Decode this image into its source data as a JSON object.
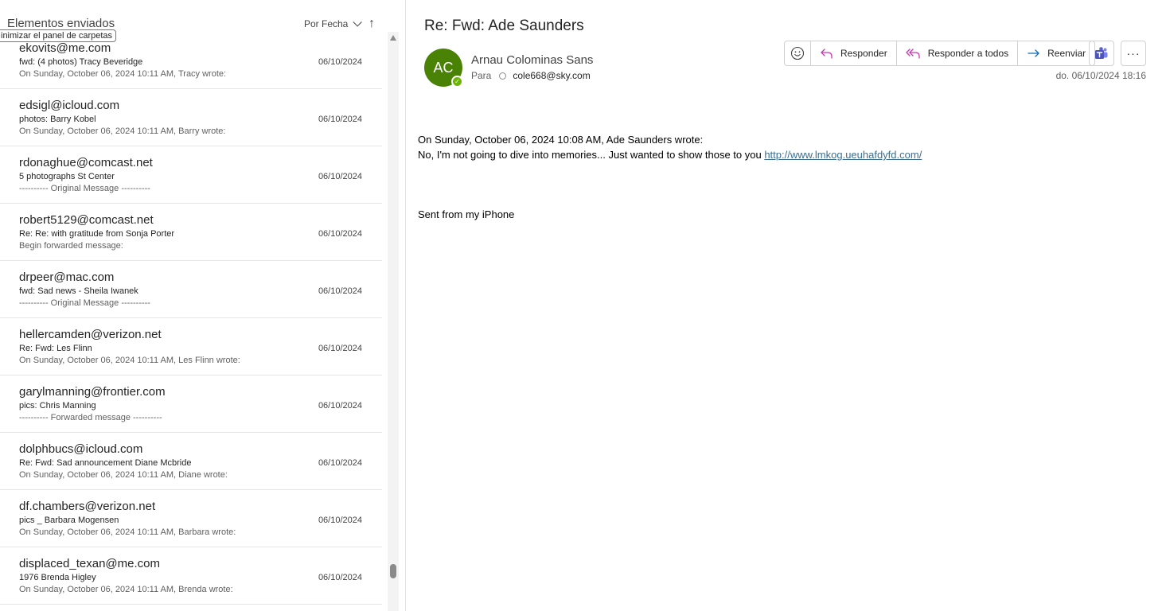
{
  "list": {
    "folder_title": "Elementos enviados",
    "sort_label": "Por Fecha",
    "sort_direction_icon": "↑",
    "tooltip": "inimizar el panel de carpetas",
    "messages": [
      {
        "from": "ekovits@me.com",
        "subject": "fwd: (4 photos) Tracy Beveridge",
        "preview": "On Sunday, October 06, 2024 10:11 AM, Tracy wrote:",
        "date": "06/10/2024"
      },
      {
        "from": "edsigl@icloud.com",
        "subject": "photos: Barry Kobel",
        "preview": "On Sunday, October 06, 2024 10:11 AM, Barry wrote:",
        "date": "06/10/2024"
      },
      {
        "from": "rdonaghue@comcast.net",
        "subject": "5 photographs St Center",
        "preview": "---------- Original Message ----------",
        "date": "06/10/2024"
      },
      {
        "from": "robert5129@comcast.net",
        "subject": "Re: Re: with gratitude from Sonja Porter",
        "preview": "Begin forwarded message:",
        "date": "06/10/2024"
      },
      {
        "from": "drpeer@mac.com",
        "subject": "fwd: Sad news - Sheila Iwanek",
        "preview": "---------- Original Message ----------",
        "date": "06/10/2024"
      },
      {
        "from": "hellercamden@verizon.net",
        "subject": "Re: Fwd: Les Flinn",
        "preview": "On Sunday, October 06, 2024 10:11 AM, Les Flinn wrote:",
        "date": "06/10/2024"
      },
      {
        "from": "garylmanning@frontier.com",
        "subject": "pics: Chris Manning",
        "preview": "---------- Forwarded message ----------",
        "date": "06/10/2024"
      },
      {
        "from": "dolphbucs@icloud.com",
        "subject": "Re: Fwd: Sad announcement Diane Mcbride",
        "preview": "On Sunday, October 06, 2024 10:11 AM, Diane wrote:",
        "date": "06/10/2024"
      },
      {
        "from": "df.chambers@verizon.net",
        "subject": "pics _ Barbara Mogensen",
        "preview": "On Sunday, October 06, 2024 10:11 AM, Barbara wrote:",
        "date": "06/10/2024"
      },
      {
        "from": "displaced_texan@me.com",
        "subject": "1976 Brenda Higley",
        "preview": "On Sunday, October 06, 2024 10:11 AM, Brenda wrote:",
        "date": "06/10/2024"
      }
    ]
  },
  "reading": {
    "subject": "Re: Fwd: Ade Saunders",
    "avatar_initials": "AC",
    "avatar_color": "#498205",
    "sender": "Arnau Colominas Sans",
    "to_label": "Para",
    "recipient": "cole668@sky.com",
    "sent_time": "do. 06/10/2024 18:16",
    "actions": {
      "emoji_icon": "smiley-icon",
      "reply": "Responder",
      "reply_all": "Responder a todos",
      "forward": "Reenviar"
    },
    "more_label": "···",
    "body": {
      "line1": "On Sunday, October 06, 2024 10:08 AM, Ade Saunders wrote:",
      "line2": "No, I'm not going to dive into memories... Just wanted to show those to you ",
      "link": "http://www.lmkog.ueuhafdyfd.com/",
      "signature": "Sent from my iPhone"
    }
  },
  "colors": {
    "accent": "#0f6cbd",
    "reply_icon": "#c239b3",
    "forward_icon": "#0f6cbd",
    "teams": "#5b5fc7"
  }
}
